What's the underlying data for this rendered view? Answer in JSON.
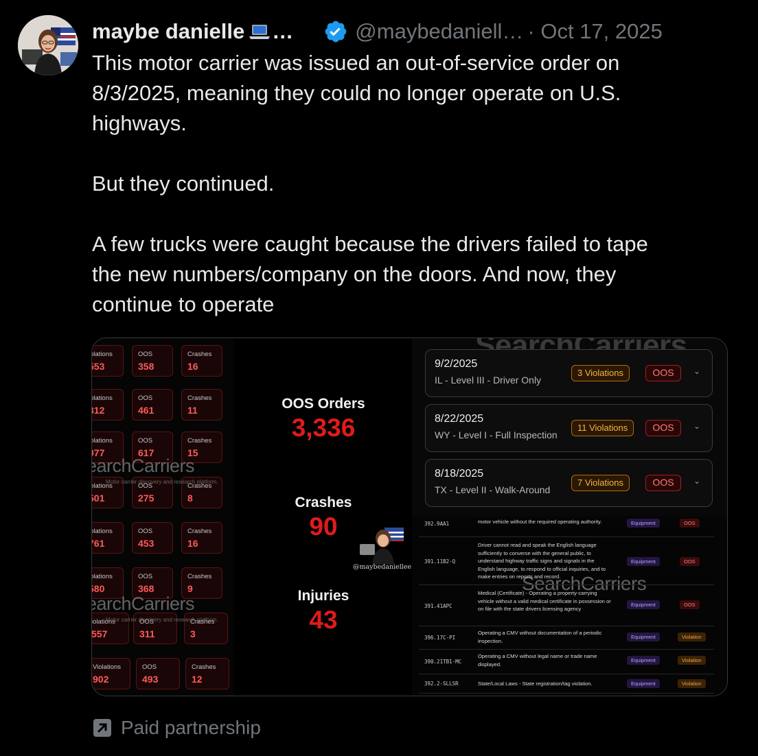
{
  "author": {
    "name": "maybe danielle",
    "name_ellipsis": "…",
    "handle": "@maybedaniell…",
    "date": "· Oct 17, 2025",
    "verified": true
  },
  "tweet": {
    "text": "This motor carrier was issued an out-of-service order on\n8/3/2025, meaning they could no longer operate on U.S.\nhighways.\n\nBut they continued.\n\nA few trucks were caught because the drivers failed to tape\nthe new numbers/company on the doors. And now, they\ncontinue to operate"
  },
  "media": {
    "grid": [
      [
        {
          "label": "iolations",
          "value": "553"
        },
        {
          "label": "OOS",
          "value": "358"
        },
        {
          "label": "Crashes",
          "value": "16"
        }
      ],
      [
        {
          "label": "iolations",
          "value": "312"
        },
        {
          "label": "OOS",
          "value": "461"
        },
        {
          "label": "Crashes",
          "value": "11"
        }
      ],
      [
        {
          "label": "iolations",
          "value": "077"
        },
        {
          "label": "OOS",
          "value": "617"
        },
        {
          "label": "Crashes",
          "value": "15"
        }
      ],
      [
        {
          "label": "iolations",
          "value": "501"
        },
        {
          "label": "OOS",
          "value": "275"
        },
        {
          "label": "Crashes",
          "value": "8"
        }
      ],
      [
        {
          "label": "iolations",
          "value": "761"
        },
        {
          "label": "OOS",
          "value": "453"
        },
        {
          "label": "Crashes",
          "value": "16"
        }
      ],
      [
        {
          "label": "iolations",
          "value": "580"
        },
        {
          "label": "OOS",
          "value": "368"
        },
        {
          "label": "Crashes",
          "value": "9"
        }
      ],
      [
        {
          "label": "iolations",
          "value": "557"
        },
        {
          "label": "OOS",
          "value": "311"
        },
        {
          "label": "Crashes",
          "value": "3"
        }
      ],
      [
        {
          "label": "Violations",
          "value": "902"
        },
        {
          "label": "OOS",
          "value": "493"
        },
        {
          "label": "Crashes",
          "value": "12"
        }
      ]
    ],
    "watermark": "SearchCarriers",
    "watermark_partial": "earchCarriers",
    "watermark_sub": "Motor carrier discovery and research platform.",
    "stats": {
      "oos_label": "OOS Orders",
      "oos_value": "3,336",
      "crashes_label": "Crashes",
      "crashes_value": "90",
      "injuries_label": "Injuries",
      "injuries_value": "43"
    },
    "mini_handle": "@maybedaniellee",
    "inspections": [
      {
        "date": "9/2/2025",
        "level": "IL - Level III - Driver Only",
        "violations": "3 Violations",
        "status": "OOS"
      },
      {
        "date": "8/22/2025",
        "level": "WY - Level I - Full Inspection",
        "violations": "11 Violations",
        "status": "OOS"
      },
      {
        "date": "8/18/2025",
        "level": "TX - Level II - Walk-Around",
        "violations": "7 Violations",
        "status": "OOS"
      }
    ],
    "violation_rows": [
      {
        "code": "392.9AA1",
        "desc": "motor vehicle without the required operating authority.",
        "category": "Equipment",
        "severity": "OOS"
      },
      {
        "code": "391.11B2-Q",
        "desc": "Driver cannot read and speak the English language sufficiently to converse with the general public, to understand highway traffic signs and signals in the English language, to respond to official inquiries, and to make entries on reports and record.",
        "category": "Equipment",
        "severity": "OOS"
      },
      {
        "code": "391.41APC",
        "desc": "Medical (Certificate) - Operating a property-carrying vehicle without a valid medical certificate in possession or on file with the state drivers licensing agency",
        "category": "Equipment",
        "severity": "OOS"
      },
      {
        "code": "396.17C-PI",
        "desc": "Operating a CMV without documentation of a periodic inspection.",
        "category": "Equipment",
        "severity": "Violation"
      },
      {
        "code": "390.21TB1-MC",
        "desc": "Operating a CMV without legal name or trade name displayed.",
        "category": "Equipment",
        "severity": "Violation"
      },
      {
        "code": "392.2-SLLSR",
        "desc": "State/Local Laws - State registration/tag violation.",
        "category": "Equipment",
        "severity": "Violation"
      }
    ]
  },
  "footer": {
    "label": "Paid partnership",
    "icon": "external-link-icon"
  },
  "colors": {
    "background": "#000000",
    "text": "#e7e9ea",
    "muted": "#71767b",
    "verified": "#1d9bf0",
    "stat_red": "#e01b1b"
  }
}
